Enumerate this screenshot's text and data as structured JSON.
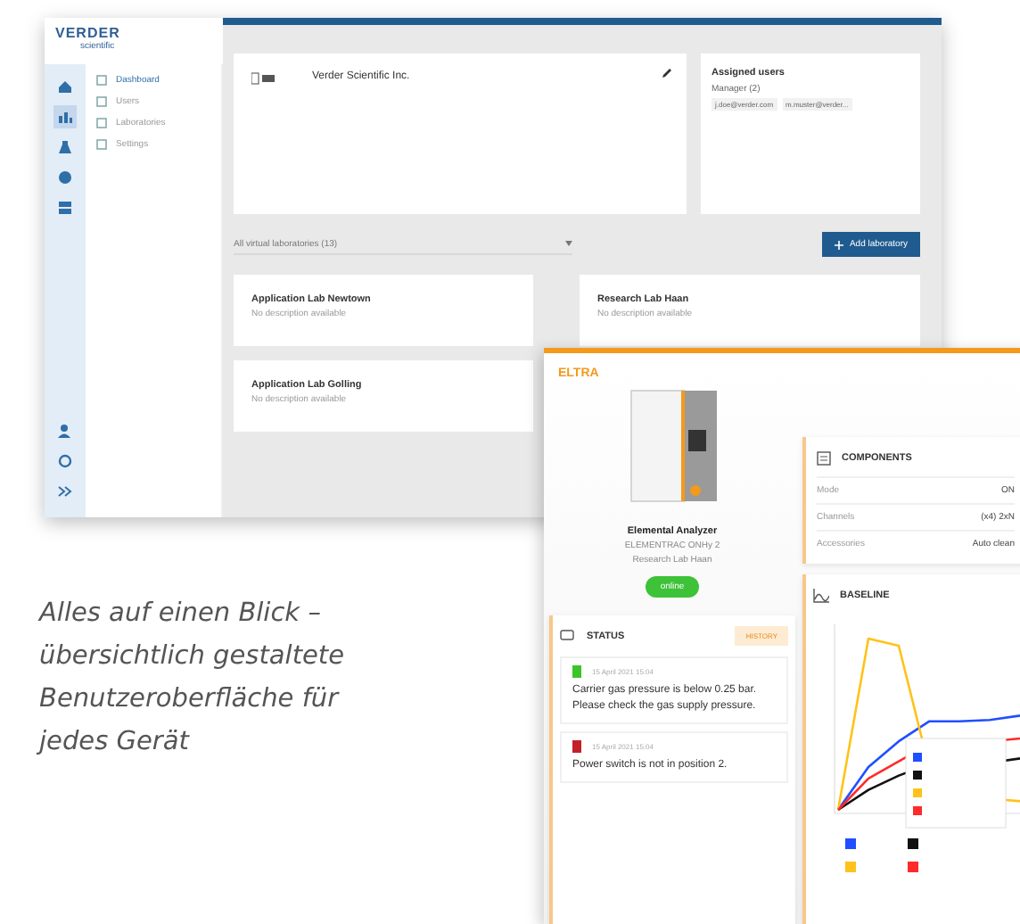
{
  "dashboard_window": {
    "logo": {
      "name": "VERDER",
      "tagline": "scientific"
    },
    "icon_rail": [
      {
        "kind": "home",
        "selected": false
      },
      {
        "kind": "chart",
        "selected": true
      },
      {
        "kind": "upload",
        "selected": false
      },
      {
        "kind": "globe",
        "selected": false
      },
      {
        "kind": "stack",
        "selected": false
      },
      {
        "kind": "user",
        "selected": false
      },
      {
        "kind": "gear",
        "selected": false
      },
      {
        "kind": "expand",
        "selected": false
      }
    ],
    "nav": [
      {
        "label": "Dashboard",
        "selected": true
      },
      {
        "label": "Users",
        "selected": false
      },
      {
        "label": "Laboratories",
        "selected": false
      },
      {
        "label": "Settings",
        "selected": false
      }
    ],
    "company_card": {
      "name": "Verder Scientific Inc."
    },
    "assigned_users": {
      "title": "Assigned users",
      "group": "Manager (2)",
      "users": [
        "j.doe@verder.com",
        "m.muster@verder..."
      ]
    },
    "lab_filter": {
      "value": "All virtual laboratories (13)"
    },
    "add_button": {
      "label": "Add laboratory"
    },
    "laboratories": [
      {
        "name": "Application Lab Newtown",
        "description": "No description available"
      },
      {
        "name": "Research Lab Haan",
        "description": "No description available"
      },
      {
        "name": "Application Lab Golling",
        "description": "No description available"
      }
    ]
  },
  "caption": "Alles auf einen Blick – übersichtlich gestaltete Benutzeroberfläche für jedes Gerät",
  "device_window": {
    "logo": "ELTRA",
    "device": {
      "type": "Elemental Analyzer",
      "model": "ELEMENTRAC ONHy 2",
      "lab": "Research Lab Haan",
      "status": "online"
    },
    "status_panel": {
      "title": "STATUS",
      "history_button": "HISTORY",
      "messages": [
        {
          "color": "#3cc42a",
          "time": "15 April 2021 15:04",
          "text": "Carrier gas pressure is below 0.25 bar. Please check the gas supply pressure."
        },
        {
          "color": "#c4202a",
          "time": "15 April 2021 15:04",
          "text": "Power switch is not in position 2."
        }
      ]
    },
    "components": {
      "title": "COMPONENTS",
      "rows": [
        {
          "label": "Mode",
          "value": "ON"
        },
        {
          "label": "Channels",
          "value": "(x4) 2xN"
        },
        {
          "label": "Accessories",
          "value": "Auto clean"
        }
      ]
    },
    "baseline": {
      "title": "BASELINE",
      "series": [
        {
          "color": "#1f4fff"
        },
        {
          "color": "#111111"
        },
        {
          "color": "#ffc21a"
        },
        {
          "color": "#ff2a2a"
        }
      ]
    }
  }
}
